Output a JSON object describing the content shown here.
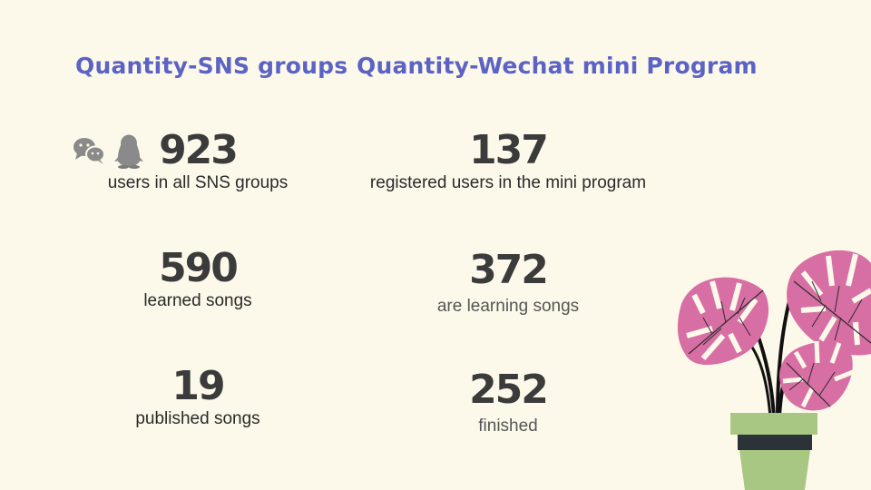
{
  "left": {
    "heading": "Quantity-SNS groups",
    "stats": [
      {
        "value": "923",
        "label": "users in all SNS groups"
      },
      {
        "value": "590",
        "label": "learned songs"
      },
      {
        "value": "19",
        "label": "published songs"
      }
    ],
    "icons": [
      "wechat-icon",
      "qq-penguin-icon"
    ]
  },
  "right": {
    "heading": "Quantity-Wechat mini Program",
    "stats": [
      {
        "value": "137",
        "label": "registered users in the mini program"
      },
      {
        "value": "372",
        "label": "are learning songs"
      },
      {
        "value": "252",
        "label": "finished"
      }
    ]
  },
  "colors": {
    "background": "#fdf9ea",
    "heading": "#5b63c4",
    "leaf": "#d86fa4",
    "pot": "#a8c782",
    "pot_band": "#2b3238"
  }
}
